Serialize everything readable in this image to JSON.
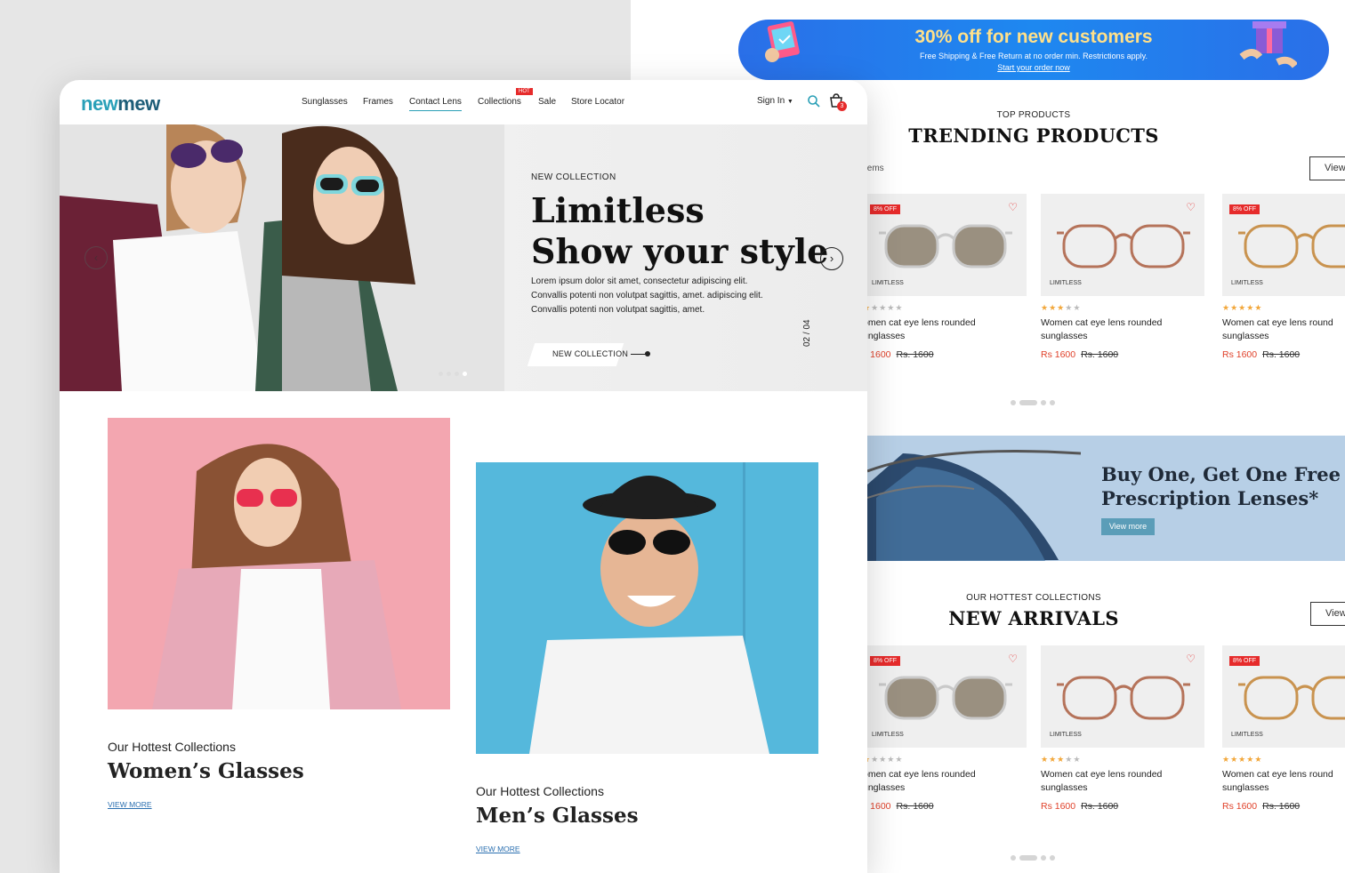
{
  "promo": {
    "headline": "30% off for new customers",
    "subline": "Free Shipping & Free Return at no order min. Restrictions apply.",
    "cta": "Start your order now"
  },
  "trending": {
    "kicker": "TOP PRODUCTS",
    "title": "TRENDING PRODUCTS",
    "items_label": "tems",
    "view_label": "View"
  },
  "new_arrivals": {
    "kicker": "OUR HOTTEST COLLECTIONS",
    "title": "NEW ARRIVALS",
    "view_label": "View"
  },
  "products": [
    {
      "badge": "8% OFF",
      "brand": "LIMITLESS",
      "name": "omen cat eye lens rounded unglasses",
      "price": "s 1600",
      "old_price": "Rs. 1600",
      "rating": 1
    },
    {
      "badge": "",
      "brand": "LIMITLESS",
      "name": "Women cat eye lens rounded sunglasses",
      "price": "Rs 1600",
      "old_price": "Rs. 1600",
      "rating": 3
    },
    {
      "badge": "8% OFF",
      "brand": "LIMITLESS",
      "name": "Women cat eye lens round sunglasses",
      "price": "Rs 1600",
      "old_price": "Rs. 1600",
      "rating": 5
    }
  ],
  "bogo": {
    "line1": "Buy One, Get One Free",
    "line2": "Prescription Lenses*",
    "button": "View more"
  },
  "header": {
    "logo_part1": "new",
    "logo_part2": "mew",
    "nav": [
      "Sunglasses",
      "Frames",
      "Contact Lens",
      "Collections",
      "Sale",
      "Store Locator"
    ],
    "hot_badge": "HOT",
    "signin": "Sign In",
    "cart_count": "3"
  },
  "hero": {
    "kicker": "NEW COLLECTION",
    "title_line1": "Limitless",
    "title_line2": "Show your style",
    "description": "Lorem ipsum dolor sit amet, consectetur adipiscing elit. Convallis potenti non volutpat sagittis, amet. adipiscing elit. Convallis potenti non volutpat sagittis, amet.",
    "cta": "NEW COLLECTION",
    "counter": "02 / 04"
  },
  "collections": {
    "women_sub": "Our Hottest Collections",
    "women_title": "Women’s Glasses",
    "women_link": "VIEW MORE",
    "men_sub": "Our Hottest Collections",
    "men_title": "Men’s Glasses",
    "men_link": "VIEW MORE"
  },
  "colors": {
    "accent": "#2a9fb6",
    "sale_red": "#e62b2b",
    "price_red": "#e0412a",
    "promo_blue": "#1e88f0"
  }
}
